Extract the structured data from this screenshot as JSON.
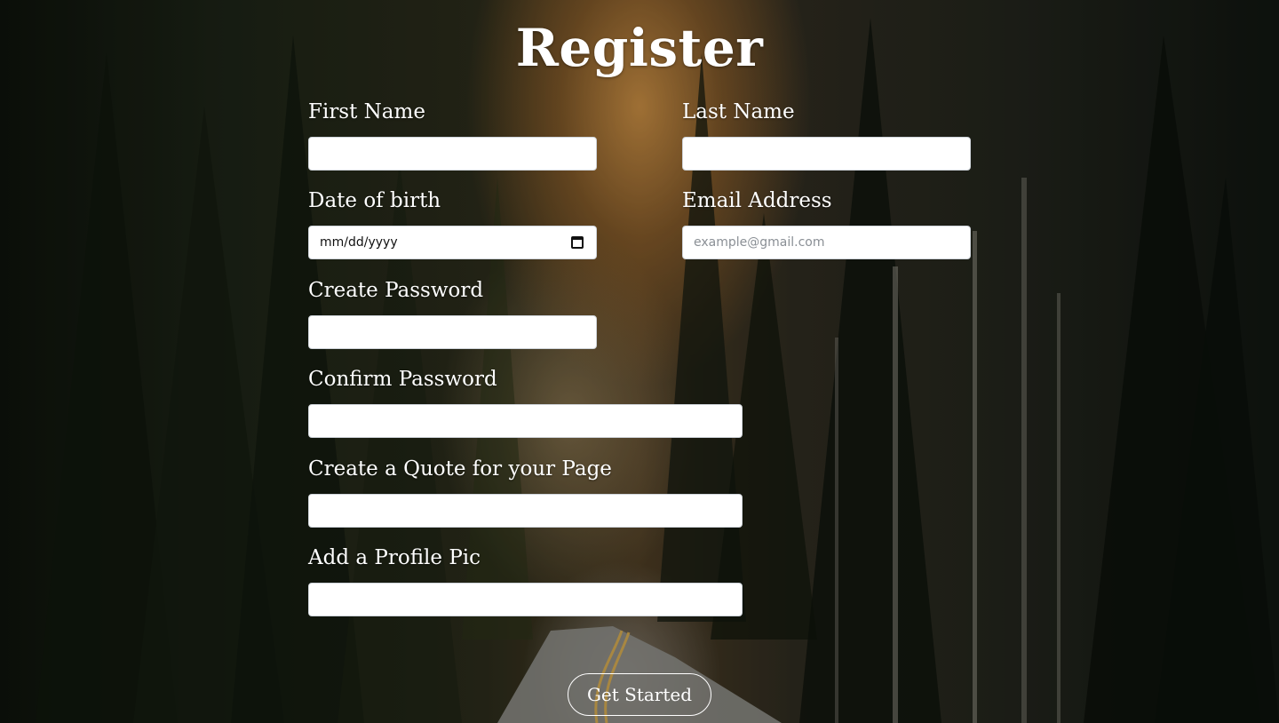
{
  "page": {
    "title": "Register"
  },
  "form": {
    "first_name": {
      "label": "First Name",
      "value": "",
      "placeholder": ""
    },
    "last_name": {
      "label": "Last Name",
      "value": "",
      "placeholder": ""
    },
    "dob": {
      "label": "Date of birth",
      "value": "mm/dd/yyyy"
    },
    "email": {
      "label": "Email Address",
      "value": "",
      "placeholder": "example@gmail.com"
    },
    "password": {
      "label": "Create Password",
      "value": "",
      "placeholder": ""
    },
    "confirm_password": {
      "label": "Confirm Password",
      "value": "",
      "placeholder": ""
    },
    "quote": {
      "label": "Create a Quote for your Page",
      "value": "",
      "placeholder": ""
    },
    "profile_pic": {
      "label": "Add a Profile Pic",
      "value": "",
      "placeholder": ""
    }
  },
  "actions": {
    "submit_label": "Get Started"
  },
  "icons": {
    "date": "calendar-icon"
  }
}
